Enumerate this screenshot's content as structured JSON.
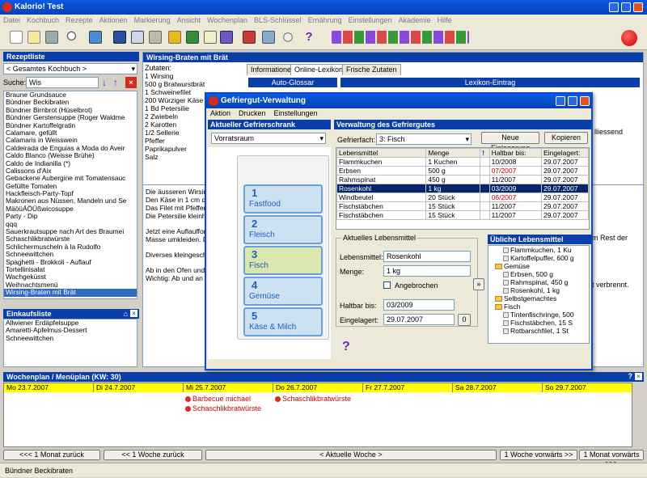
{
  "app": {
    "title": "Kalorio!   Test",
    "status": "Bündner Beckibraten"
  },
  "menu": [
    "Datei",
    "Kochbuch",
    "Rezepte",
    "Aktionen",
    "Markierung",
    "Ansicht",
    "Wochenplan",
    "BLS-Schlüssel",
    "Ernährung",
    "Einstellungen",
    "Akademie",
    "Hilfe"
  ],
  "rezeptliste": {
    "title": "Rezeptliste",
    "kochbuch": "< Gesamtes Kochbuch >",
    "search_label": "Suche:",
    "search_value": "Wis",
    "items": [
      "Braune Grundsauce",
      "Bündner Beckibraten",
      "Bündner Birnbrot (Hüselbrot)",
      "Bündner Gerstensuppe (Roger Waldme",
      "Bündner Kartoffelgratin",
      "Calamare, gefüllt",
      "Calamaris in Weisswein",
      "Caldeirada de Enguias a Moda do Aveir",
      "Caldo Blanco (Weisse Brühe)",
      "Caldo de Indianilla (*)",
      "Calissons d'Aix",
      "Gebackene Aubergine mit Tomatensauc",
      "Gefüllte Tomaten",
      "Hackfleisch-Party-Topf",
      "Makronen aus Nüssen, Mandeln und Se",
      "MäöüÄÖÜßwicosuppe",
      "Party - Dip",
      "qqq",
      "Sauerkrautsuppe nach Art des Braumei",
      "Schaschlikbratwürste",
      "Schlichermuscheln à la Rudolfo",
      "Schneewittchen",
      "Spaghetti - Brokkoli - Auflauf",
      "Tortellinisalat",
      "Wachgeküsst",
      "Weihnachtsmenü",
      "Wirsing-Braten mit Brät"
    ]
  },
  "einkaufsliste": {
    "title": "Einkaufsliste",
    "items": [
      "Allwiener Erdäpfelsuppe",
      "Amaretti-Apfelmus-Dessert",
      "Schneewittchen"
    ]
  },
  "recipe": {
    "title": "Wirsing-Braten mit Brät",
    "zutaten_label": "Zutaten:",
    "zutaten": [
      "1 Wirsing",
      "500 g Bratwurstbrät",
      "1 Schweinefilet",
      "200 Würziger Käse",
      "1 Bd Petersilie",
      "2 Zwiebeln",
      "2 Karotten",
      "1/2 Sellerie",
      "Pfeffer",
      "Paprikapulver",
      "Salz"
    ],
    "tabs": [
      "Informationen",
      "Online-Lexikon",
      "Frische Zutaten"
    ],
    "auto_glossar": "Auto-Glossar",
    "lexikon_eintrag": "Lexikon-Eintrag",
    "text": [
      "Die äusseren Wirsing",
      "Den Käse in 1 cm di",
      "Das Filet mit Pfeffer u",
      "Die Petersilie kleinha",
      "Jetzt eine Auflaufform",
      "Masse umkleiden. Da",
      "Diverses kleingeschn",
      "Ab in den Ofen und l",
      "Wichtig: Ab und an d"
    ],
    "right_fragments": [
      "lliessend",
      "m Rest der",
      "t verbrennt."
    ]
  },
  "wochenplan": {
    "title": "Wochenplan / Menüplan  (KW: 30)",
    "days": [
      "Mo 23.7.2007",
      "Di 24.7.2007",
      "Mi 25.7.2007",
      "Do 26.7.2007",
      "Fr 27.7.2007",
      "Sa 28.7.2007",
      "So 29.7.2007"
    ],
    "entries": {
      "mi": [
        "Barbecue michael",
        "Schaschlikbratwürste"
      ],
      "do": [
        "Schaschlikbratwürste"
      ]
    },
    "nav": [
      "<<< 1 Monat zurück",
      "<< 1 Woche zurück",
      "< Aktuelle Woche >",
      "1 Woche vorwärts >>",
      "1 Monat vorwärts >>>"
    ]
  },
  "dialog": {
    "title": "Gefriergut-Verwaltung",
    "menu": [
      "Aktion",
      "Drucken",
      "Einstellungen"
    ],
    "left_head": "Aktueller Gefrierschrank",
    "schrank": "Vorratsraum",
    "drawers": [
      {
        "num": "1",
        "label": "Fastfood"
      },
      {
        "num": "2",
        "label": "Fleisch"
      },
      {
        "num": "3",
        "label": "Fisch"
      },
      {
        "num": "4",
        "label": "Gemüse"
      },
      {
        "num": "5",
        "label": "Käse & Milch"
      }
    ],
    "right_head": "Verwaltung des Gefriergutes",
    "fach_label": "Gefrierfach:",
    "fach_value": "3: Fisch",
    "btn_neu": "Neue Einlagerung",
    "btn_kopieren": "Kopieren",
    "table_headers": [
      "Lebensmittel",
      "Menge",
      "!",
      "Haltbar bis:",
      "Eingelagert:"
    ],
    "rows": [
      {
        "name": "Flammkuchen",
        "menge": "1 Kuchen",
        "haltbar": "10/2008",
        "einge": "29.07.2007",
        "expired": false
      },
      {
        "name": "Erbsen",
        "menge": "500 g",
        "haltbar": "07/2007",
        "einge": "29.07.2007",
        "expired": true
      },
      {
        "name": "Rahmspinat",
        "menge": "450 g",
        "haltbar": "11/2007",
        "einge": "29.07.2007",
        "expired": false
      },
      {
        "name": "Rosenkohl",
        "menge": "1 kg",
        "haltbar": "03/2009",
        "einge": "29.07.2007",
        "expired": false,
        "selected": true
      },
      {
        "name": "Windbeutel",
        "menge": "20 Stück",
        "haltbar": "06/2007",
        "einge": "29.07.2007",
        "expired": true
      },
      {
        "name": "Fischstäbchen",
        "menge": "15 Stück",
        "haltbar": "11/2007",
        "einge": "29.07.2007",
        "expired": false
      },
      {
        "name": "Fischstäbchen",
        "menge": "15 Stück",
        "haltbar": "11/2007",
        "einge": "29.07.2007",
        "expired": false
      }
    ],
    "current_group": "Aktuelles Lebensmittel",
    "lm_label": "Lebensmittel:",
    "lm_value": "Rosenkohl",
    "menge_label": "Menge:",
    "menge_value": "1 kg",
    "angebrochen": "Angebrochen",
    "haltbar_label": "Haltbar bis:",
    "haltbar_value": "03/2009",
    "eingelagert_label": "Eingelagert:",
    "eingelagert_value": "29.07.2007",
    "btn_zero": "0",
    "btn_arrow": "»",
    "help": "?",
    "ueblich_head": "Übliche Lebensmittel",
    "tree": [
      "Flammkuchen, 1 Ku",
      "Kartoffelpuffer, 600 g",
      "Gemüse",
      "Erbsen, 500 g",
      "Rahmspinat, 450 g",
      "Rosenkohl, 1 kg",
      "Selbstgemachtes",
      "Fisch",
      "Tintenfischringe, 500",
      "Fischstäbchen, 15 S",
      "Rotbarschfilet, 1 St"
    ]
  }
}
